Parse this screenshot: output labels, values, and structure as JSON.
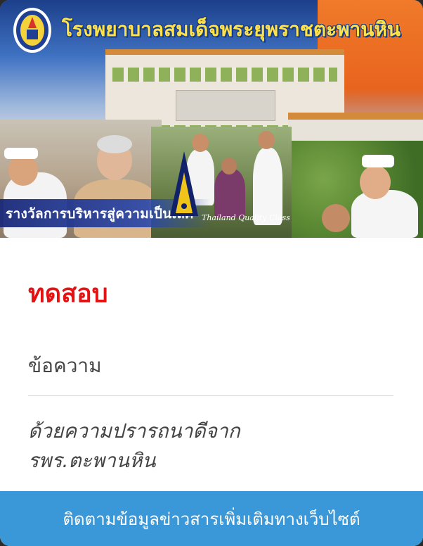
{
  "banner": {
    "hospital_name": "โรงพยาบาลสมเด็จพระยุพราชตะพานหิน",
    "award_text": "รางวัลการบริหารสู่ความเป็นเลิศ",
    "quality_text": "Thailand Quality Class"
  },
  "content": {
    "title": "ทดสอบ",
    "message_label": "ข้อความ",
    "signature_line1": "ด้วยความปรารถนาดีจาก",
    "signature_line2": "รพร.ตะพานหิน"
  },
  "footer": {
    "button_label": "ติดตามข้อมูลข่าวสารเพิ่มเติมทางเว็บไซต์"
  },
  "colors": {
    "title_red": "#e31313",
    "button_blue": "#3a97d8",
    "hospital_name_yellow": "#ffe14a"
  }
}
